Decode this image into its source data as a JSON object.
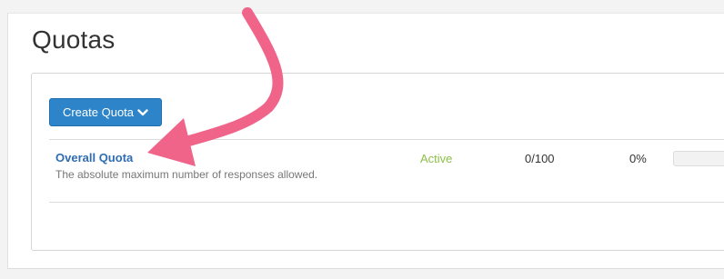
{
  "page": {
    "title": "Quotas"
  },
  "toolbar": {
    "create_label": "Create Quota",
    "create_icon": "chevron-down-icon"
  },
  "quotas": [
    {
      "name": "Overall Quota",
      "description": "The absolute maximum number of responses allowed.",
      "status": "Active",
      "count": "0/100",
      "percent": "0%",
      "progress": 0
    }
  ],
  "colors": {
    "accent": "#2d84c8",
    "link": "#2f6db3",
    "active": "#8cc04a",
    "annotation_arrow": "#f0648a"
  }
}
